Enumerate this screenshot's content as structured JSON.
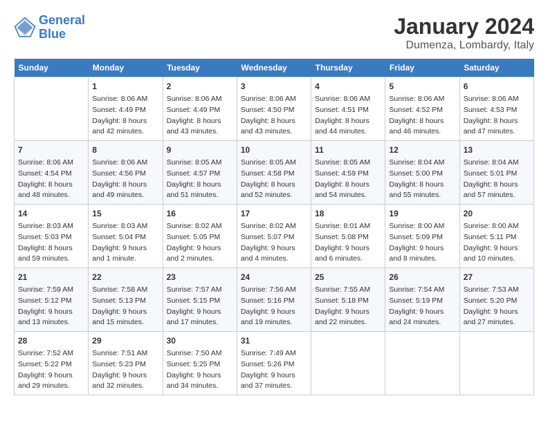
{
  "header": {
    "logo_line1": "General",
    "logo_line2": "Blue",
    "month": "January 2024",
    "location": "Dumenza, Lombardy, Italy"
  },
  "weekdays": [
    "Sunday",
    "Monday",
    "Tuesday",
    "Wednesday",
    "Thursday",
    "Friday",
    "Saturday"
  ],
  "weeks": [
    [
      {
        "day": "",
        "sunrise": "",
        "sunset": "",
        "daylight": ""
      },
      {
        "day": "1",
        "sunrise": "Sunrise: 8:06 AM",
        "sunset": "Sunset: 4:49 PM",
        "daylight": "Daylight: 8 hours and 42 minutes."
      },
      {
        "day": "2",
        "sunrise": "Sunrise: 8:06 AM",
        "sunset": "Sunset: 4:49 PM",
        "daylight": "Daylight: 8 hours and 43 minutes."
      },
      {
        "day": "3",
        "sunrise": "Sunrise: 8:06 AM",
        "sunset": "Sunset: 4:50 PM",
        "daylight": "Daylight: 8 hours and 43 minutes."
      },
      {
        "day": "4",
        "sunrise": "Sunrise: 8:06 AM",
        "sunset": "Sunset: 4:51 PM",
        "daylight": "Daylight: 8 hours and 44 minutes."
      },
      {
        "day": "5",
        "sunrise": "Sunrise: 8:06 AM",
        "sunset": "Sunset: 4:52 PM",
        "daylight": "Daylight: 8 hours and 46 minutes."
      },
      {
        "day": "6",
        "sunrise": "Sunrise: 8:06 AM",
        "sunset": "Sunset: 4:53 PM",
        "daylight": "Daylight: 8 hours and 47 minutes."
      }
    ],
    [
      {
        "day": "7",
        "sunrise": "Sunrise: 8:06 AM",
        "sunset": "Sunset: 4:54 PM",
        "daylight": "Daylight: 8 hours and 48 minutes."
      },
      {
        "day": "8",
        "sunrise": "Sunrise: 8:06 AM",
        "sunset": "Sunset: 4:56 PM",
        "daylight": "Daylight: 8 hours and 49 minutes."
      },
      {
        "day": "9",
        "sunrise": "Sunrise: 8:05 AM",
        "sunset": "Sunset: 4:57 PM",
        "daylight": "Daylight: 8 hours and 51 minutes."
      },
      {
        "day": "10",
        "sunrise": "Sunrise: 8:05 AM",
        "sunset": "Sunset: 4:58 PM",
        "daylight": "Daylight: 8 hours and 52 minutes."
      },
      {
        "day": "11",
        "sunrise": "Sunrise: 8:05 AM",
        "sunset": "Sunset: 4:59 PM",
        "daylight": "Daylight: 8 hours and 54 minutes."
      },
      {
        "day": "12",
        "sunrise": "Sunrise: 8:04 AM",
        "sunset": "Sunset: 5:00 PM",
        "daylight": "Daylight: 8 hours and 55 minutes."
      },
      {
        "day": "13",
        "sunrise": "Sunrise: 8:04 AM",
        "sunset": "Sunset: 5:01 PM",
        "daylight": "Daylight: 8 hours and 57 minutes."
      }
    ],
    [
      {
        "day": "14",
        "sunrise": "Sunrise: 8:03 AM",
        "sunset": "Sunset: 5:03 PM",
        "daylight": "Daylight: 8 hours and 59 minutes."
      },
      {
        "day": "15",
        "sunrise": "Sunrise: 8:03 AM",
        "sunset": "Sunset: 5:04 PM",
        "daylight": "Daylight: 9 hours and 1 minute."
      },
      {
        "day": "16",
        "sunrise": "Sunrise: 8:02 AM",
        "sunset": "Sunset: 5:05 PM",
        "daylight": "Daylight: 9 hours and 2 minutes."
      },
      {
        "day": "17",
        "sunrise": "Sunrise: 8:02 AM",
        "sunset": "Sunset: 5:07 PM",
        "daylight": "Daylight: 9 hours and 4 minutes."
      },
      {
        "day": "18",
        "sunrise": "Sunrise: 8:01 AM",
        "sunset": "Sunset: 5:08 PM",
        "daylight": "Daylight: 9 hours and 6 minutes."
      },
      {
        "day": "19",
        "sunrise": "Sunrise: 8:00 AM",
        "sunset": "Sunset: 5:09 PM",
        "daylight": "Daylight: 9 hours and 8 minutes."
      },
      {
        "day": "20",
        "sunrise": "Sunrise: 8:00 AM",
        "sunset": "Sunset: 5:11 PM",
        "daylight": "Daylight: 9 hours and 10 minutes."
      }
    ],
    [
      {
        "day": "21",
        "sunrise": "Sunrise: 7:59 AM",
        "sunset": "Sunset: 5:12 PM",
        "daylight": "Daylight: 9 hours and 13 minutes."
      },
      {
        "day": "22",
        "sunrise": "Sunrise: 7:58 AM",
        "sunset": "Sunset: 5:13 PM",
        "daylight": "Daylight: 9 hours and 15 minutes."
      },
      {
        "day": "23",
        "sunrise": "Sunrise: 7:57 AM",
        "sunset": "Sunset: 5:15 PM",
        "daylight": "Daylight: 9 hours and 17 minutes."
      },
      {
        "day": "24",
        "sunrise": "Sunrise: 7:56 AM",
        "sunset": "Sunset: 5:16 PM",
        "daylight": "Daylight: 9 hours and 19 minutes."
      },
      {
        "day": "25",
        "sunrise": "Sunrise: 7:55 AM",
        "sunset": "Sunset: 5:18 PM",
        "daylight": "Daylight: 9 hours and 22 minutes."
      },
      {
        "day": "26",
        "sunrise": "Sunrise: 7:54 AM",
        "sunset": "Sunset: 5:19 PM",
        "daylight": "Daylight: 9 hours and 24 minutes."
      },
      {
        "day": "27",
        "sunrise": "Sunrise: 7:53 AM",
        "sunset": "Sunset: 5:20 PM",
        "daylight": "Daylight: 9 hours and 27 minutes."
      }
    ],
    [
      {
        "day": "28",
        "sunrise": "Sunrise: 7:52 AM",
        "sunset": "Sunset: 5:22 PM",
        "daylight": "Daylight: 9 hours and 29 minutes."
      },
      {
        "day": "29",
        "sunrise": "Sunrise: 7:51 AM",
        "sunset": "Sunset: 5:23 PM",
        "daylight": "Daylight: 9 hours and 32 minutes."
      },
      {
        "day": "30",
        "sunrise": "Sunrise: 7:50 AM",
        "sunset": "Sunset: 5:25 PM",
        "daylight": "Daylight: 9 hours and 34 minutes."
      },
      {
        "day": "31",
        "sunrise": "Sunrise: 7:49 AM",
        "sunset": "Sunset: 5:26 PM",
        "daylight": "Daylight: 9 hours and 37 minutes."
      },
      {
        "day": "",
        "sunrise": "",
        "sunset": "",
        "daylight": ""
      },
      {
        "day": "",
        "sunrise": "",
        "sunset": "",
        "daylight": ""
      },
      {
        "day": "",
        "sunrise": "",
        "sunset": "",
        "daylight": ""
      }
    ]
  ]
}
